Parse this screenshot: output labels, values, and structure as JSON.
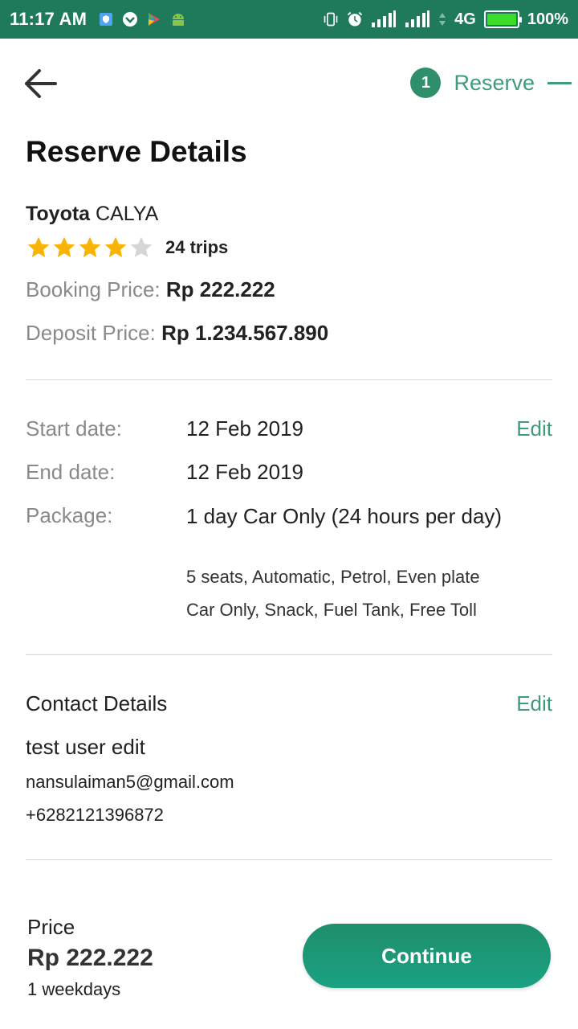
{
  "status_bar": {
    "time": "11:17 AM",
    "network": "4G",
    "battery": "100%",
    "battery_level": 1.0,
    "left_icons": [
      "shield-icon",
      "vpn-icon",
      "play-store-icon",
      "android-icon"
    ],
    "right_icons": [
      "vibrate-icon",
      "alarm-icon",
      "signal-icon",
      "signal-icon",
      "data-arrows-icon",
      "battery-icon"
    ]
  },
  "header": {
    "back_icon": "arrow-left-icon",
    "step_number": "1",
    "step_label": "Reserve"
  },
  "page": {
    "title": "Reserve Details"
  },
  "car": {
    "brand": "Toyota",
    "model": "CALYA",
    "rating": 4,
    "rating_max": 5,
    "trips": "24 trips",
    "booking_price_label": "Booking Price:",
    "booking_price": "Rp 222.222",
    "deposit_price_label": "Deposit Price:",
    "deposit_price": "Rp 1.234.567.890"
  },
  "details": {
    "start_label": "Start date:",
    "start_value": "12 Feb 2019",
    "end_label": "End date:",
    "end_value": "12 Feb 2019",
    "package_label": "Package:",
    "package_value": "1 day Car Only (24 hours per day)",
    "package_specs": "5 seats, Automatic, Petrol, Even plate",
    "package_includes": "Car Only, Snack, Fuel Tank, Free Toll",
    "edit_label": "Edit"
  },
  "contact": {
    "title": "Contact Details",
    "edit_label": "Edit",
    "name": "test user edit",
    "email": "nansulaiman5@gmail.com",
    "phone": "+6282121396872"
  },
  "footer": {
    "price_label": "Price",
    "price_value": "Rp 222.222",
    "price_note": "1 weekdays",
    "continue_label": "Continue"
  },
  "colors": {
    "status_bar": "#1f7a5c",
    "accent": "#3f9b78",
    "button": "#1a9a78",
    "star_filled": "#f7b500",
    "star_empty": "#d6d6d6"
  }
}
